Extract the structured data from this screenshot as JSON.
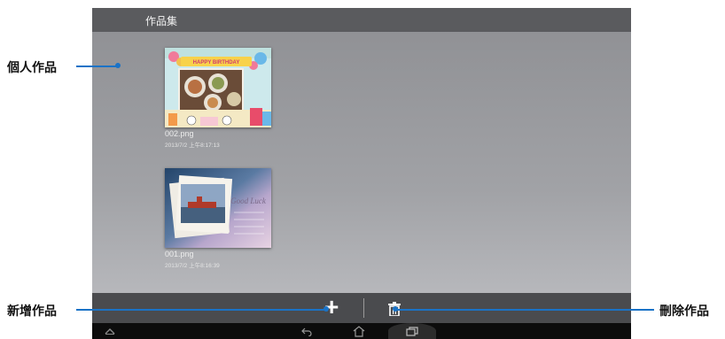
{
  "window": {
    "title": "作品集"
  },
  "files": [
    {
      "name": "002.png",
      "date": "2013/7/2 上午8:17:13"
    },
    {
      "name": "001.png",
      "date": "2013/7/2 上午8:16:39"
    }
  ],
  "thumbs": {
    "banner": "HAPPY BIRTHDAY",
    "card_text": "Good Luck"
  },
  "toolbar": {
    "add_icon": "plus-icon",
    "delete_icon": "trash-icon"
  },
  "navbar": {
    "icons": [
      "collapse-up-icon",
      "back-icon",
      "home-icon",
      "recent-apps-icon"
    ]
  },
  "callouts": {
    "personal_works": "個人作品",
    "add_work": "新增作品",
    "delete_work": "刪除作品"
  },
  "colors": {
    "callout_line": "#1a73c7",
    "titlebar": "#5a5b5e",
    "bottombar": "#4a4b4e"
  }
}
